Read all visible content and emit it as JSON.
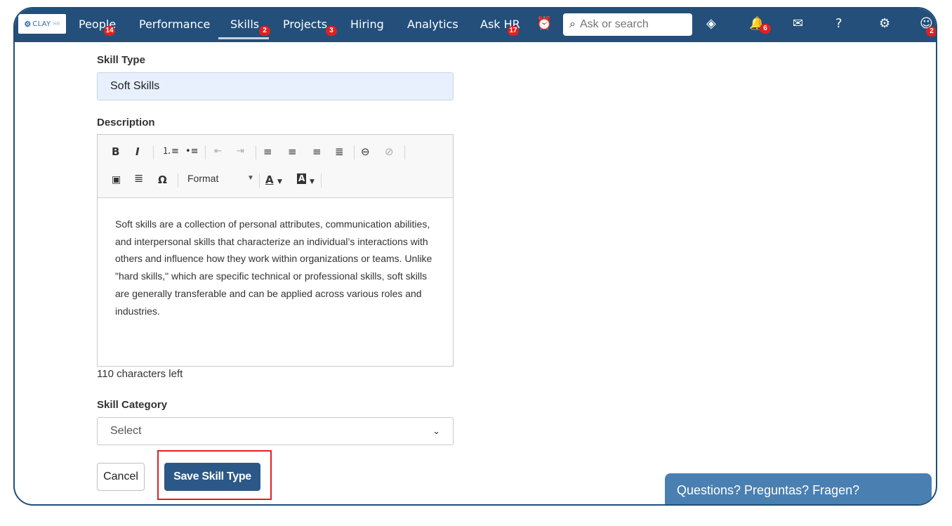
{
  "app": {
    "logo_text": "CLAY",
    "logo_suffix": "HR"
  },
  "nav": {
    "items": [
      {
        "label": "People",
        "badge": "14"
      },
      {
        "label": "Performance",
        "badge": ""
      },
      {
        "label": "Skills",
        "badge": "2",
        "active": true
      },
      {
        "label": "Projects",
        "badge": "3"
      },
      {
        "label": "Hiring",
        "badge": ""
      },
      {
        "label": "Analytics",
        "badge": ""
      },
      {
        "label": "Ask HR",
        "badge": "17"
      }
    ],
    "search_placeholder": "Ask or search",
    "notifications_badge": "6",
    "profile_badge": "2"
  },
  "form": {
    "skill_type_label": "Skill Type",
    "skill_type_value": "Soft Skills",
    "description_label": "Description",
    "description_text": "Soft skills are a collection of personal attributes, communication abilities, and interpersonal skills that characterize an individual’s interactions with others and influence how they work within organizations or teams. Unlike \"hard skills,\" which are specific technical or professional skills, soft skills are generally transferable and can be applied across various roles and industries.",
    "chars_left": "110 characters left",
    "category_label": "Skill Category",
    "category_value": "Select",
    "cancel_label": "Cancel",
    "save_label": "Save Skill Type"
  },
  "editor_toolbar": {
    "bold": "B",
    "italic": "I",
    "format_label": "Format",
    "omega": "Ω",
    "text_color": "A",
    "bg_color": "A"
  },
  "help": {
    "label": "Questions? Preguntas? Fragen?"
  },
  "colors": {
    "topbar": "#234f7a",
    "primary_button": "#2b5887",
    "badge": "#e02020",
    "help_tab": "#4a7fb2",
    "highlight": "#e02020"
  }
}
